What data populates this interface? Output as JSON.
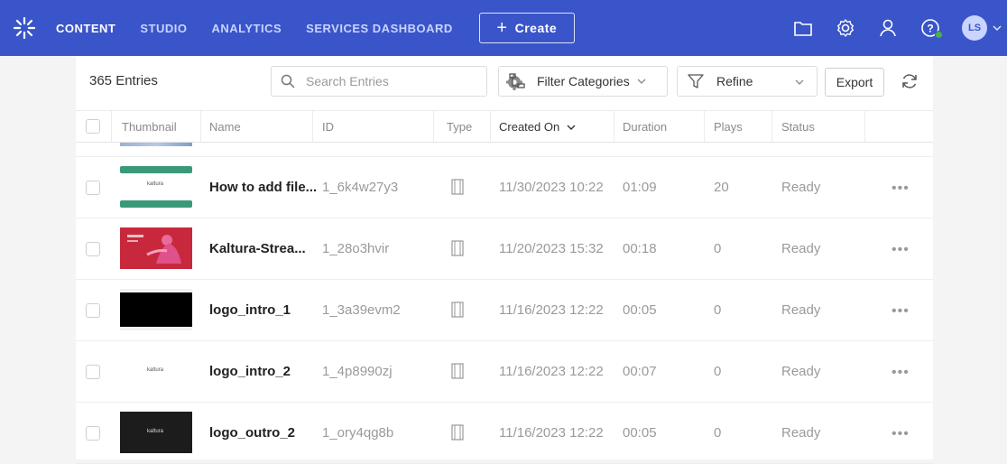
{
  "nav": {
    "items": [
      {
        "label": "CONTENT",
        "active": true
      },
      {
        "label": "STUDIO",
        "active": false
      },
      {
        "label": "ANALYTICS",
        "active": false
      },
      {
        "label": "SERVICES DASHBOARD",
        "active": false
      }
    ],
    "create_label": "Create",
    "icons": [
      "folder-icon",
      "settings-icon",
      "user-icon",
      "help-icon"
    ],
    "avatar_initials": "LS"
  },
  "toolbar": {
    "entries_count": "365 Entries",
    "search_placeholder": "Search Entries",
    "filter_label": "Filter Categories",
    "refine_label": "Refine",
    "export_label": "Export"
  },
  "table": {
    "columns": {
      "thumbnail": "Thumbnail",
      "name": "Name",
      "id": "ID",
      "type": "Type",
      "created_on": "Created On",
      "duration": "Duration",
      "plays": "Plays",
      "status": "Status"
    },
    "rows": [
      {
        "name": "How to add file...",
        "id": "1_6k4w27y3",
        "created_on": "11/30/2023 10:22",
        "duration": "01:09",
        "plays": "20",
        "status": "Ready",
        "thumb": "green-kaltura"
      },
      {
        "name": "Kaltura-Strea...",
        "id": "1_28o3hvir",
        "created_on": "11/20/2023 15:32",
        "duration": "00:18",
        "plays": "0",
        "status": "Ready",
        "thumb": "red-figure"
      },
      {
        "name": "logo_intro_1",
        "id": "1_3a39evm2",
        "created_on": "11/16/2023 12:22",
        "duration": "00:05",
        "plays": "0",
        "status": "Ready",
        "thumb": "black"
      },
      {
        "name": "logo_intro_2",
        "id": "1_4p8990zj",
        "created_on": "11/16/2023 12:22",
        "duration": "00:07",
        "plays": "0",
        "status": "Ready",
        "thumb": "white-kaltura"
      },
      {
        "name": "logo_outro_2",
        "id": "1_ory4qg8b",
        "created_on": "11/16/2023 12:22",
        "duration": "00:05",
        "plays": "0",
        "status": "Ready",
        "thumb": "dark-kaltura"
      }
    ],
    "thumb_text": "kaltura",
    "more_label": "•••"
  },
  "colors": {
    "nav_bg": "#3a55c9",
    "thumb_green": "#3a9a78",
    "thumb_red": "#c8283c"
  }
}
